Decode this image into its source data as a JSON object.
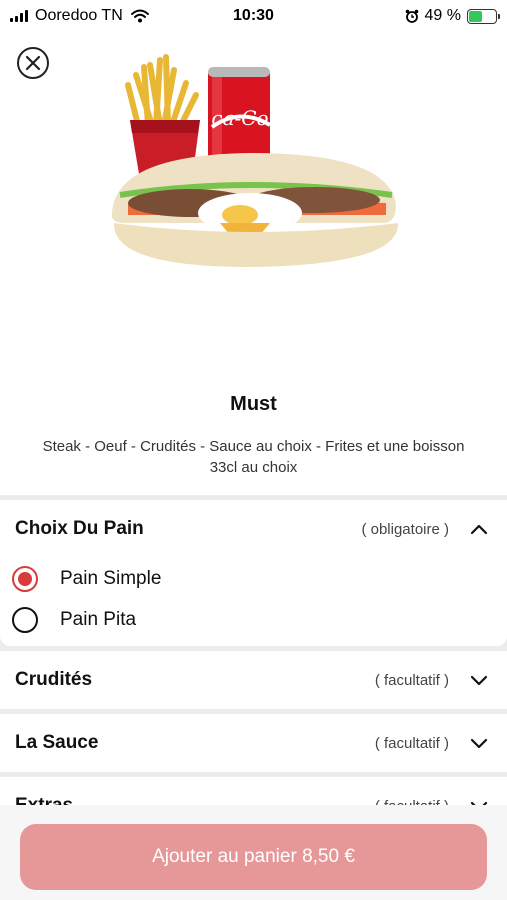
{
  "status_bar": {
    "carrier": "Ooredoo TN",
    "time": "10:30",
    "battery_percent": "49 %",
    "battery_level": 0.49
  },
  "product": {
    "name": "Must",
    "description": "Steak - Oeuf - Crudités - Sauce au choix - Frites et une boisson 33cl au choix"
  },
  "sections": [
    {
      "title": "Choix Du Pain",
      "tag": "( obligatoire )",
      "expanded": true,
      "options": [
        {
          "label": "Pain Simple",
          "selected": true
        },
        {
          "label": "Pain Pita",
          "selected": false
        }
      ]
    },
    {
      "title": "Crudités",
      "tag": "( facultatif )",
      "expanded": false
    },
    {
      "title": "La Sauce",
      "tag": "( facultatif )",
      "expanded": false
    },
    {
      "title": "Extras",
      "tag": "( facultatif )",
      "expanded": false
    }
  ],
  "cart_button": {
    "label": "Ajouter au panier 8,50 €"
  },
  "icons": {
    "close": "close-icon",
    "chevron_up": "chevron-up-icon",
    "chevron_down": "chevron-down-icon",
    "radio_selected": "radio-selected-icon",
    "radio_empty": "radio-empty-icon"
  },
  "colors": {
    "accent": "#d93a3a",
    "button": "#e69898",
    "background_sections": "#ececec"
  }
}
